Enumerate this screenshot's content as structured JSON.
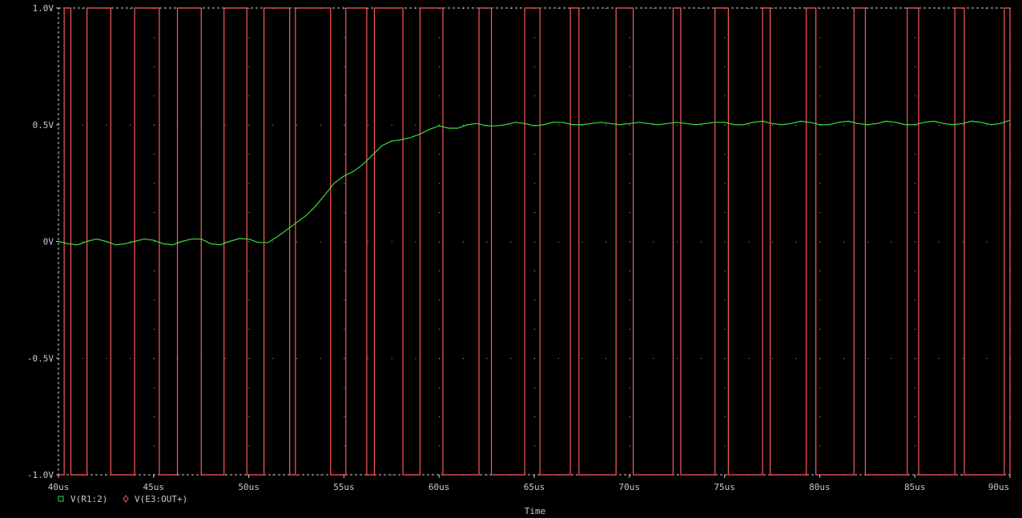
{
  "chart_data": {
    "type": "line",
    "xlabel": "Time",
    "ylabel": "",
    "xlim": [
      40,
      90
    ],
    "ylim": [
      -1.0,
      1.0
    ],
    "x_unit": "us",
    "x_ticks": [
      "40us",
      "45us",
      "50us",
      "55us",
      "60us",
      "65us",
      "70us",
      "75us",
      "80us",
      "85us",
      "90us"
    ],
    "x_tick_values": [
      40,
      45,
      50,
      55,
      60,
      65,
      70,
      75,
      80,
      85,
      90
    ],
    "y_ticks": [
      "1.0V",
      "0.5V",
      "0V",
      "-0.5V",
      "-1.0V"
    ],
    "y_tick_values": [
      1.0,
      0.5,
      0,
      -0.5,
      -1.0
    ],
    "grid": "dotted",
    "legend_position": "bottom-left",
    "series": [
      {
        "name": "V(R1:2)",
        "color": "#3ddc3d",
        "marker": "square",
        "x": [
          40,
          40.5,
          41,
          41.5,
          42,
          42.5,
          43,
          43.5,
          44,
          44.5,
          45,
          45.5,
          46,
          46.5,
          47,
          47.5,
          48,
          48.5,
          49,
          49.5,
          50,
          50.5,
          51,
          51.5,
          52,
          52.5,
          53,
          53.5,
          54,
          54.5,
          55,
          55.5,
          56,
          56.5,
          57,
          57.5,
          58,
          58.5,
          59,
          59.5,
          60,
          60.5,
          61,
          61.5,
          62,
          62.5,
          63,
          63.5,
          64,
          64.5,
          65,
          65.5,
          66,
          66.5,
          67,
          67.5,
          68,
          68.5,
          69,
          69.5,
          70,
          70.5,
          71,
          71.5,
          72,
          72.5,
          73,
          73.5,
          74,
          74.5,
          75,
          75.5,
          76,
          76.5,
          77,
          77.5,
          78,
          78.5,
          79,
          79.5,
          80,
          80.5,
          81,
          81.5,
          82,
          82.5,
          83,
          83.5,
          84,
          84.5,
          85,
          85.5,
          86,
          86.5,
          87,
          87.5,
          88,
          88.5,
          89,
          89.5,
          90
        ],
        "values": [
          0.0,
          -0.01,
          -0.015,
          0.0,
          0.01,
          0.0,
          -0.015,
          -0.01,
          0.0,
          0.01,
          0.005,
          -0.01,
          -0.015,
          0.0,
          0.01,
          0.01,
          -0.01,
          -0.015,
          0.0,
          0.012,
          0.01,
          -0.005,
          -0.005,
          0.02,
          0.05,
          0.08,
          0.11,
          0.15,
          0.2,
          0.25,
          0.28,
          0.3,
          0.33,
          0.37,
          0.41,
          0.43,
          0.435,
          0.445,
          0.46,
          0.48,
          0.495,
          0.485,
          0.485,
          0.5,
          0.505,
          0.495,
          0.495,
          0.5,
          0.51,
          0.505,
          0.495,
          0.5,
          0.51,
          0.51,
          0.5,
          0.5,
          0.505,
          0.51,
          0.505,
          0.5,
          0.505,
          0.51,
          0.505,
          0.5,
          0.505,
          0.51,
          0.505,
          0.5,
          0.505,
          0.51,
          0.51,
          0.5,
          0.5,
          0.51,
          0.515,
          0.505,
          0.5,
          0.505,
          0.515,
          0.51,
          0.5,
          0.5,
          0.51,
          0.515,
          0.505,
          0.5,
          0.505,
          0.515,
          0.51,
          0.5,
          0.5,
          0.51,
          0.515,
          0.505,
          0.5,
          0.505,
          0.515,
          0.51,
          0.5,
          0.505,
          0.52
        ]
      },
      {
        "name": "V(E3:OUT+)",
        "color": "#ff5a5a",
        "marker": "diamond",
        "initial": -1,
        "transitions_us": [
          40.3,
          40.65,
          41.5,
          42.75,
          44.0,
          45.3,
          46.25,
          47.5,
          48.7,
          49.9,
          50.8,
          52.15,
          52.45,
          54.3,
          55.1,
          56.2,
          56.6,
          58.1,
          59.0,
          60.2,
          62.1,
          62.75,
          64.5,
          65.3,
          66.9,
          67.35,
          69.3,
          70.2,
          72.3,
          72.7,
          74.5,
          75.2,
          77.0,
          77.4,
          79.3,
          79.8,
          81.8,
          82.4,
          84.6,
          85.2,
          87.1,
          87.6,
          89.7,
          90.0
        ],
        "values_note_levels": [
          1.0,
          -1.0
        ]
      }
    ]
  }
}
